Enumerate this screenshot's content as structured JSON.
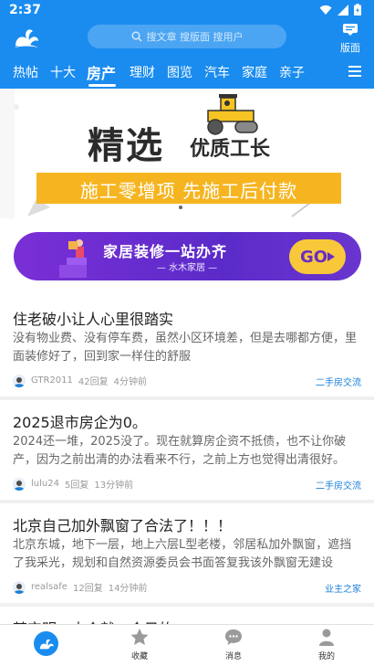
{
  "status": {
    "time": "2:37"
  },
  "search": {
    "placeholder": "搜文章 搜版面 搜用户"
  },
  "header": {
    "banmian_label": "版面"
  },
  "tabs": [
    {
      "label": "热帖"
    },
    {
      "label": "十大"
    },
    {
      "label": "房产",
      "active": true
    },
    {
      "label": "理财"
    },
    {
      "label": "图览"
    },
    {
      "label": "汽车"
    },
    {
      "label": "家庭"
    },
    {
      "label": "亲子"
    }
  ],
  "banner": {
    "title": "精选",
    "subtitle": "优质工长",
    "strip": "施工零增项  先施工后付款",
    "accent": "#f6b520"
  },
  "promo": {
    "title": "家居装修一站办齐",
    "subtitle": "— 水木家居 —",
    "go": "GO"
  },
  "posts": [
    {
      "title": "住老破小让人心里很踏实",
      "body": "没有物业费、没有停车费，虽然小区环境差，但是去哪都方便，里面装修好了，回到家一样住的舒服",
      "author": "GTR2011",
      "replies": "42回复",
      "time": "4分钟前",
      "forum": "二手房交流"
    },
    {
      "title": "2025退市房企为0。",
      "body": "2024还一堆，2025没了。现在就算房企资不抵债，也不让你破产，因为之前出清的办法看来不行，之前上方也觉得出清很好。",
      "author": "lulu24",
      "replies": "5回复",
      "time": "13分钟前",
      "forum": "二手房交流"
    },
    {
      "title": "北京自己加外飘窗了合法了！！！",
      "body": "北京东城，地下一层，地上六层L型老楼，邻居私加外飘窗，遮挡了我采光，规划和自然资源委员会书面答复我该外飘窗无建设",
      "author": "realsafe",
      "replies": "12回复",
      "time": "14分钟前",
      "forum": "业主之家"
    },
    {
      "title": "某宝明，中介就一个目的"
    }
  ],
  "nav": [
    {
      "label": "",
      "icon": "home-logo-icon"
    },
    {
      "label": "收藏",
      "icon": "star-icon"
    },
    {
      "label": "消息",
      "icon": "chat-icon"
    },
    {
      "label": "我的",
      "icon": "profile-icon"
    }
  ],
  "colors": {
    "brand": "#1a8cf0",
    "link": "#1a7fd8",
    "promo": "#5b2bc9"
  }
}
